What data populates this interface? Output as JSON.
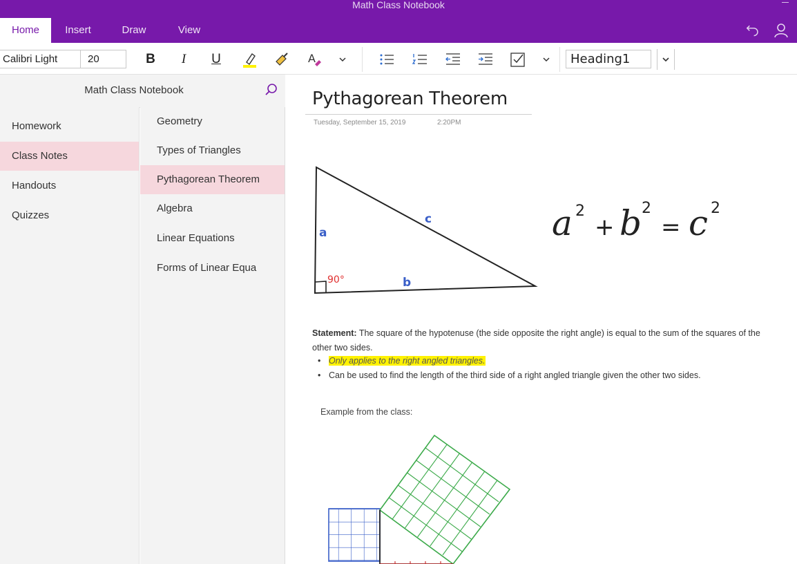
{
  "window": {
    "title": "Math Class Notebook"
  },
  "ribbon": {
    "tabs": [
      {
        "label": "Home",
        "active": true
      },
      {
        "label": "Insert",
        "active": false
      },
      {
        "label": "Draw",
        "active": false
      },
      {
        "label": "View",
        "active": false
      }
    ],
    "icons": [
      "undo-icon",
      "account-icon"
    ]
  },
  "toolbar": {
    "font_name": "Calibri Light",
    "font_size": "20",
    "bold_label": "B",
    "italic_label": "I",
    "underline_label": "U",
    "style_value": "Heading1",
    "icons": [
      "highlighter-icon",
      "format-painter-icon",
      "font-color-icon",
      "chevron-down-icon",
      "bullet-list-icon",
      "numbered-list-icon",
      "decrease-indent-icon",
      "increase-indent-icon",
      "checkbox-tag-icon",
      "chevron-down-icon"
    ],
    "accent_colors": {
      "highlight": "#fff200",
      "font_color": "#c0399b"
    }
  },
  "notebook": {
    "name": "Math Class Notebook",
    "search_icon": "search-icon",
    "sections": [
      {
        "label": "Homework",
        "selected": false
      },
      {
        "label": "Class Notes",
        "selected": true
      },
      {
        "label": "Handouts",
        "selected": false
      },
      {
        "label": "Quizzes",
        "selected": false
      }
    ],
    "pages": [
      {
        "label": "Geometry",
        "selected": false
      },
      {
        "label": "Types of Triangles",
        "selected": false
      },
      {
        "label": "Pythagorean Theorem",
        "selected": true
      },
      {
        "label": "Algebra",
        "selected": false
      },
      {
        "label": "Linear Equations",
        "selected": false
      },
      {
        "label": "Forms of Linear Equa",
        "selected": false
      }
    ]
  },
  "page": {
    "title": "Pythagorean Theorem",
    "date": "Tuesday, September 15, 2019",
    "time": "2:20PM",
    "drawing": {
      "label_a": "a",
      "label_b": "b",
      "label_c": "c",
      "angle": "90°",
      "formula": {
        "base_a": "a",
        "base_b": "b",
        "base_c": "c",
        "exponent": "2",
        "plus": "+",
        "equals": "="
      }
    },
    "statement_label": "Statement:",
    "statement_text": "The square of the hypotenuse (the side opposite the right angle) is equal to the sum of the squares of the other two sides.",
    "bullets": [
      "Only applies to the right angled triangles.",
      "Can be used to find the length of the third side of a right angled triangle given the other two sides."
    ],
    "example_label": "Example from the class:",
    "colors": {
      "ink_black": "#222222",
      "ink_blue": "#3a5fc8",
      "ink_red": "#e03030",
      "grid_green": "#3caa4a",
      "grid_blue": "#3a5fc8",
      "grid_red": "#c83030",
      "brand_purple": "#7719aa"
    }
  }
}
